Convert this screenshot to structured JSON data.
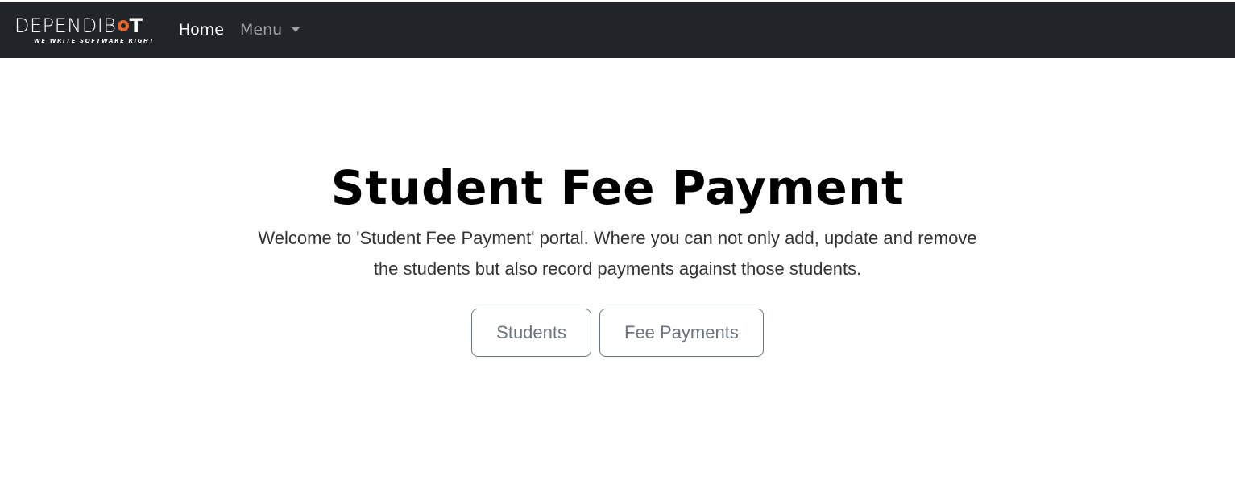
{
  "navbar": {
    "brand": {
      "part1": "DEPENDIB",
      "part2": "T",
      "tagline": "WE WRITE SOFTWARE RIGHT",
      "accent_color": "#e8622c"
    },
    "links": {
      "home": "Home",
      "menu": "Menu"
    }
  },
  "hero": {
    "title": "Student Fee Payment",
    "lead": "Welcome to 'Student Fee Payment' portal. Where you can not only add, update and remove the students but also record payments against those students.",
    "buttons": {
      "students": "Students",
      "fee_payments": "Fee Payments"
    }
  }
}
